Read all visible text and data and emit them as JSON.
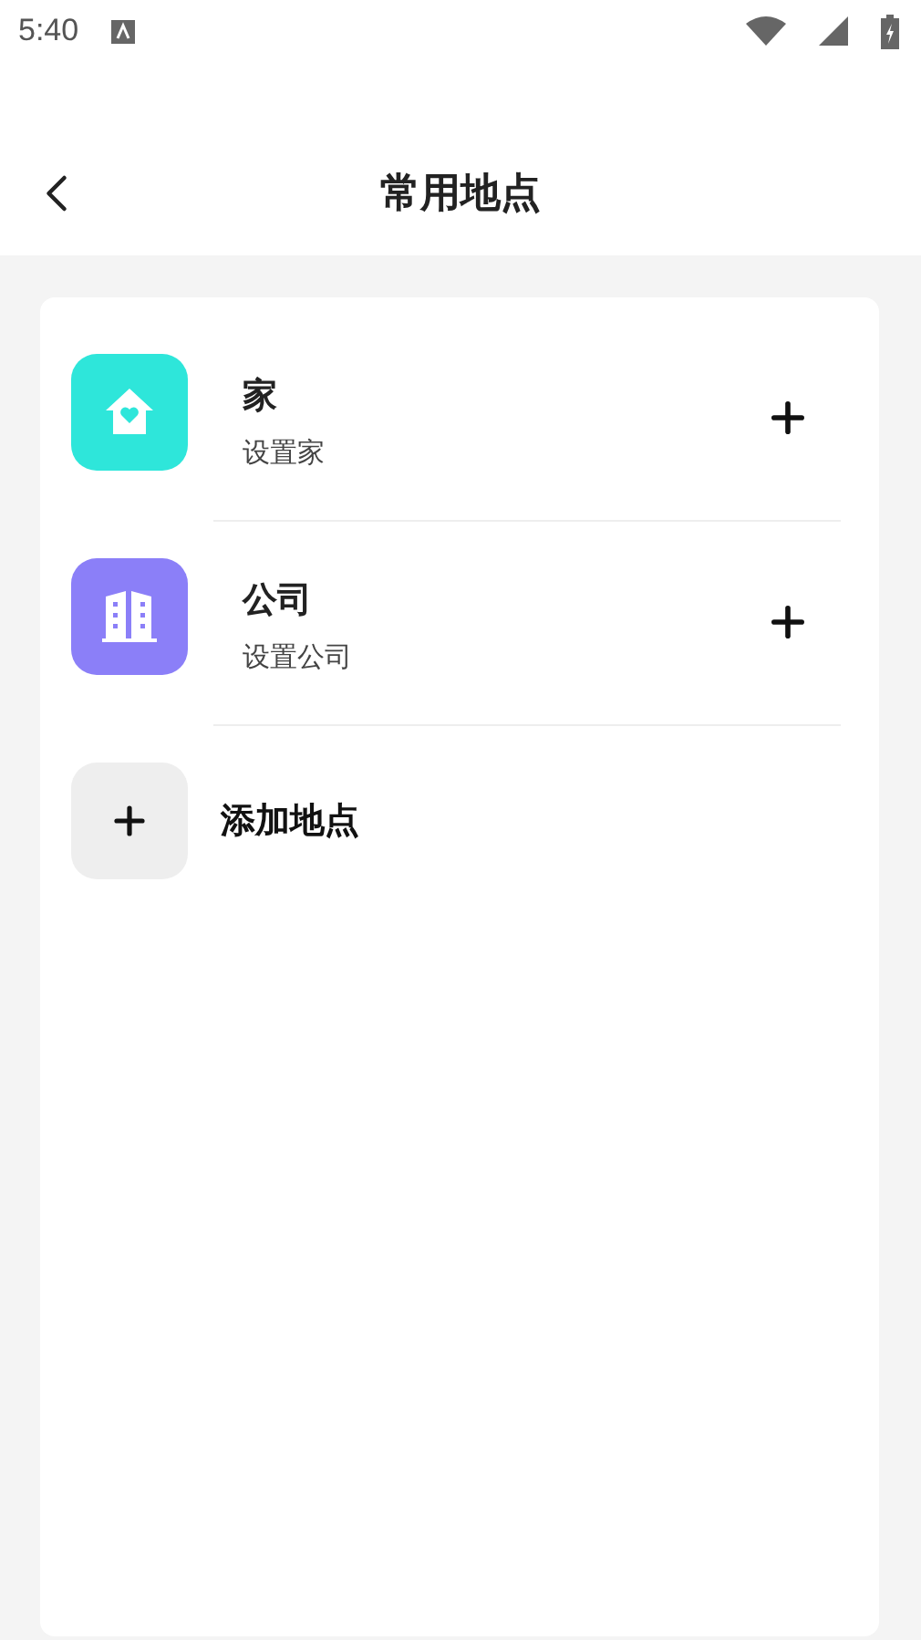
{
  "status_bar": {
    "time": "5:40"
  },
  "header": {
    "title": "常用地点"
  },
  "places": [
    {
      "kind": "home",
      "name": "家",
      "subtitle": "设置家",
      "color": "#2ee6da"
    },
    {
      "kind": "company",
      "name": "公司",
      "subtitle": "设置公司",
      "color": "#8b7ff8"
    }
  ],
  "add_place": {
    "label": "添加地点"
  }
}
